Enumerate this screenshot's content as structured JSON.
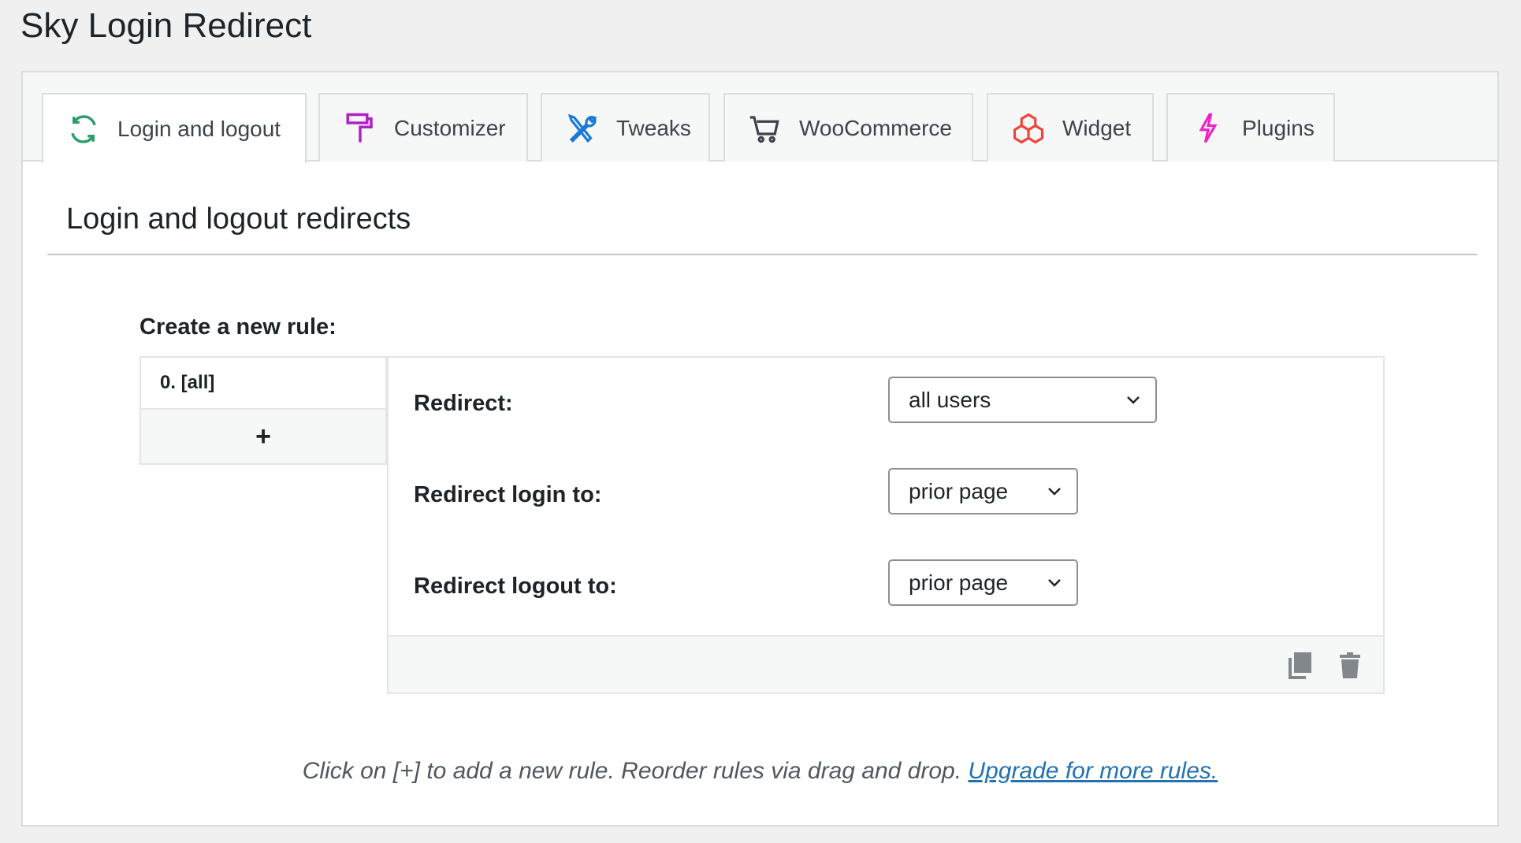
{
  "page_title": "Sky Login Redirect",
  "tabs": [
    {
      "label": "Login and logout",
      "icon": "refresh-icon",
      "color": "#2e9d6b"
    },
    {
      "label": "Customizer",
      "icon": "paint-roller-icon",
      "color": "#b020c8"
    },
    {
      "label": "Tweaks",
      "icon": "tools-icon",
      "color": "#1a7ad8"
    },
    {
      "label": "WooCommerce",
      "icon": "cart-icon",
      "color": "#3c434a"
    },
    {
      "label": "Widget",
      "icon": "cubes-icon",
      "color": "#f0443a"
    },
    {
      "label": "Plugins",
      "icon": "lightning-icon",
      "color": "#f01fc8"
    }
  ],
  "section_heading": "Login and logout redirects",
  "create_label": "Create a new rule:",
  "rules": [
    {
      "label": "0. [all]"
    }
  ],
  "add_rule_label": "+",
  "form": {
    "redirect_label": "Redirect:",
    "redirect_value": "all users",
    "login_label": "Redirect login to:",
    "login_value": "prior page",
    "logout_label": "Redirect logout to:",
    "logout_value": "prior page"
  },
  "note": "Click on [+] to add a new rule. Reorder rules via drag and drop.",
  "upgrade_link": "Upgrade for more rules."
}
